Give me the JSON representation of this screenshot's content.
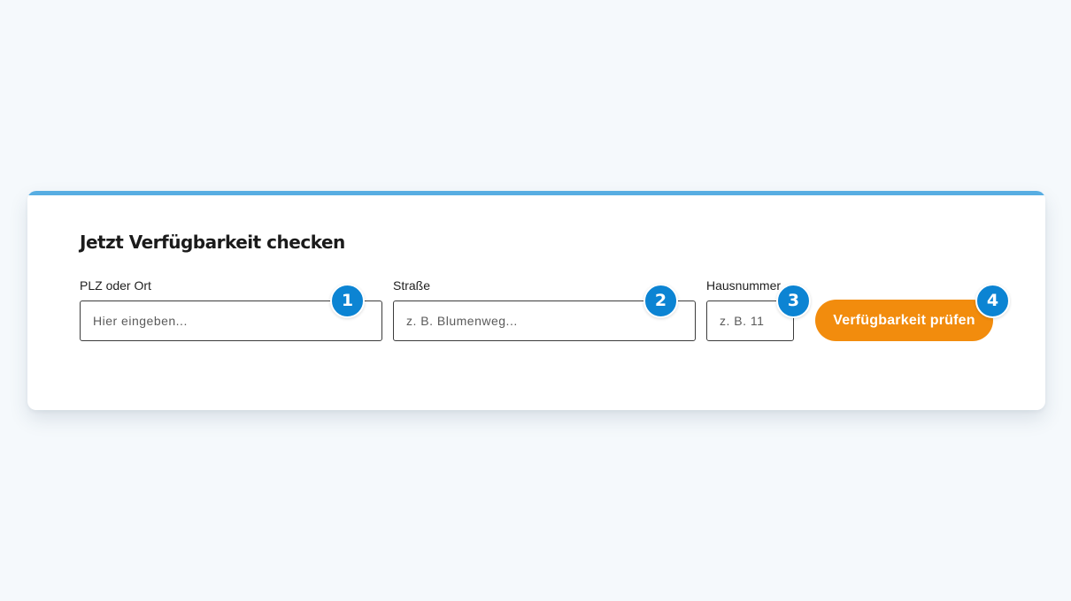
{
  "form": {
    "title": "Jetzt Verfügbarkeit checken",
    "fields": [
      {
        "label": "PLZ oder Ort",
        "placeholder": "Hier eingeben..."
      },
      {
        "label": "Straße",
        "placeholder": "z. B. Blumenweg..."
      },
      {
        "label": "Hausnummer",
        "placeholder": "z. B. 11"
      }
    ],
    "submit_label": "Verfügbarkeit prüfen"
  },
  "callouts": [
    "1",
    "2",
    "3",
    "4"
  ],
  "colors": {
    "background": "#f5f9fc",
    "card_accent": "#57ade2",
    "button": "#f28c0d",
    "badge": "#0c84d3"
  }
}
